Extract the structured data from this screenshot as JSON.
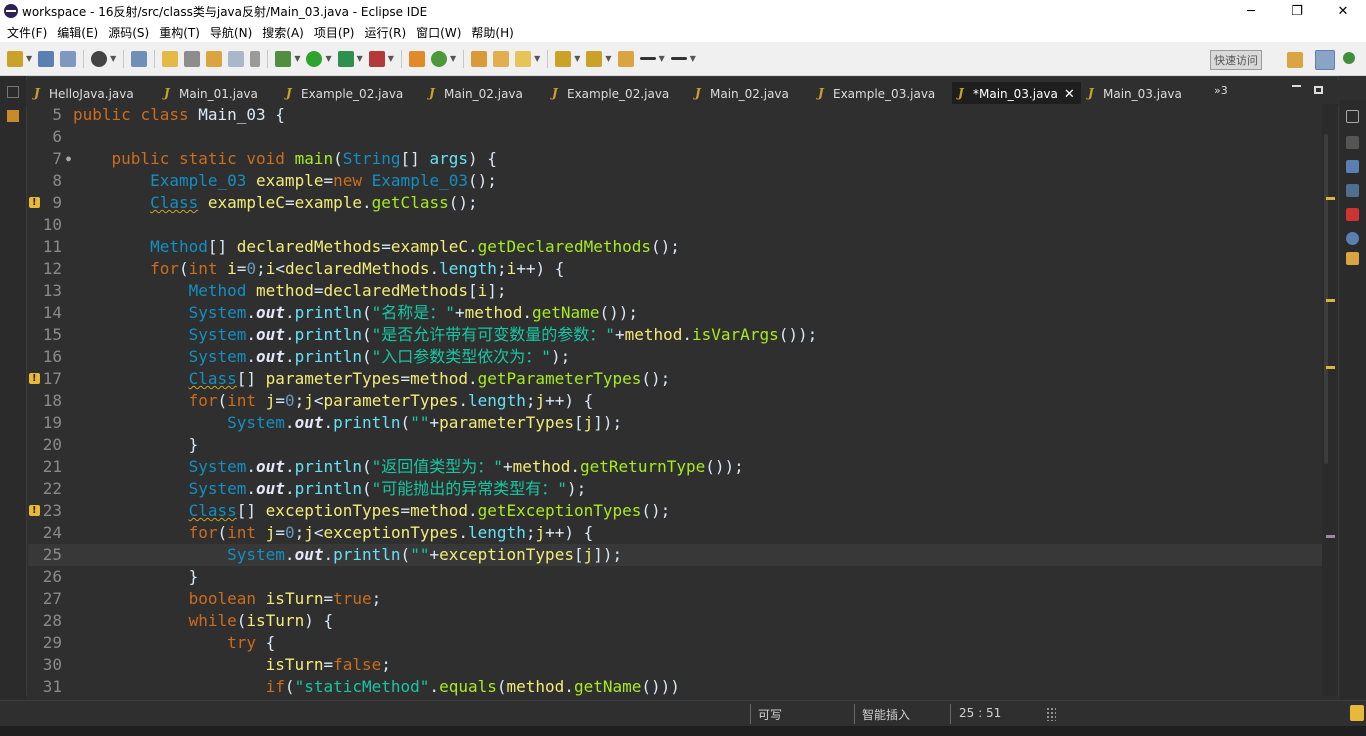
{
  "window": {
    "title": "workspace - 16反射/src/class类与java反射/Main_03.java - Eclipse IDE",
    "controls": {
      "minimize": "─",
      "maximize": "❐",
      "close": "✕"
    }
  },
  "menu": [
    "文件(F)",
    "编辑(E)",
    "源码(S)",
    "重构(T)",
    "导航(N)",
    "搜索(A)",
    "项目(P)",
    "运行(R)",
    "窗口(W)",
    "帮助(H)"
  ],
  "toolbar": {
    "quick_access_label": "快速访问",
    "icons": [
      "new-icon",
      "save-icon",
      "save-all-icon",
      "debug-perspective-icon",
      "skip-breakpoints-icon",
      "mark-occurrences-icon",
      "toggle-block-selection-icon",
      "show-whitespace-icon",
      "run-icon",
      "debug-icon",
      "coverage-icon",
      "external-tools-icon",
      "new-java-project-icon",
      "open-type-icon",
      "search-icon",
      "next-annotation-icon",
      "previous-annotation-icon",
      "back-icon",
      "forward-icon"
    ]
  },
  "tabs": [
    {
      "label": "HelloJava.java",
      "active": false
    },
    {
      "label": "Main_01.java",
      "active": false
    },
    {
      "label": "Example_02.java",
      "active": false
    },
    {
      "label": "Main_02.java",
      "active": false
    },
    {
      "label": "Example_02.java",
      "active": false
    },
    {
      "label": "Main_02.java",
      "active": false
    },
    {
      "label": "Example_03.java",
      "active": false
    },
    {
      "label": "*Main_03.java",
      "active": true
    },
    {
      "label": "Main_03.java",
      "active": false
    }
  ],
  "tab_overflow": "»3",
  "code_lines": [
    {
      "n": "5",
      "text": "public class Main_03 {"
    },
    {
      "n": "6",
      "text": ""
    },
    {
      "n": "7",
      "text": "    public static void main(String[] args) {"
    },
    {
      "n": "8",
      "text": "        Example_03 example=new Example_03();"
    },
    {
      "n": "9",
      "text": "        Class exampleC=example.getClass();"
    },
    {
      "n": "10",
      "text": ""
    },
    {
      "n": "11",
      "text": "        Method[] declaredMethods=exampleC.getDeclaredMethods();"
    },
    {
      "n": "12",
      "text": "        for(int i=0;i<declaredMethods.length;i++) {"
    },
    {
      "n": "13",
      "text": "            Method method=declaredMethods[i];"
    },
    {
      "n": "14",
      "text": "            System.out.println(\"名称是：\"+method.getName());"
    },
    {
      "n": "15",
      "text": "            System.out.println(\"是否允许带有可变数量的参数：\"+method.isVarArgs());"
    },
    {
      "n": "16",
      "text": "            System.out.println(\"入口参数类型依次为：\");"
    },
    {
      "n": "17",
      "text": "            Class[] parameterTypes=method.getParameterTypes();"
    },
    {
      "n": "18",
      "text": "            for(int j=0;j<parameterTypes.length;j++) {"
    },
    {
      "n": "19",
      "text": "                System.out.println(\"\"+parameterTypes[j]);"
    },
    {
      "n": "20",
      "text": "            }"
    },
    {
      "n": "21",
      "text": "            System.out.println(\"返回值类型为：\"+method.getReturnType());"
    },
    {
      "n": "22",
      "text": "            System.out.println(\"可能抛出的异常类型有：\");"
    },
    {
      "n": "23",
      "text": "            Class[] exceptionTypes=method.getExceptionTypes();"
    },
    {
      "n": "24",
      "text": "            for(int j=0;j<exceptionTypes.length;j++) {"
    },
    {
      "n": "25",
      "text": "                System.out.println(\"\"+exceptionTypes[j]);"
    },
    {
      "n": "26",
      "text": "            }"
    },
    {
      "n": "27",
      "text": "            boolean isTurn=true;"
    },
    {
      "n": "28",
      "text": "            while(isTurn) {"
    },
    {
      "n": "29",
      "text": "                try {"
    },
    {
      "n": "30",
      "text": "                    isTurn=false;"
    },
    {
      "n": "31",
      "text": "                    if(\"staticMethod\".equals(method.getName()))"
    }
  ],
  "warning_lines": [
    "9",
    "17",
    "23"
  ],
  "current_line": "25",
  "status": {
    "writable": "可写",
    "insert_mode": "智能插入",
    "position": "25 : 51"
  },
  "colors": {
    "editor_bg": "#2f2f2f",
    "keyword": "#cc6c1d",
    "type": "#1290c3",
    "string": "#17c6a3",
    "warning": "#e8b83a"
  }
}
